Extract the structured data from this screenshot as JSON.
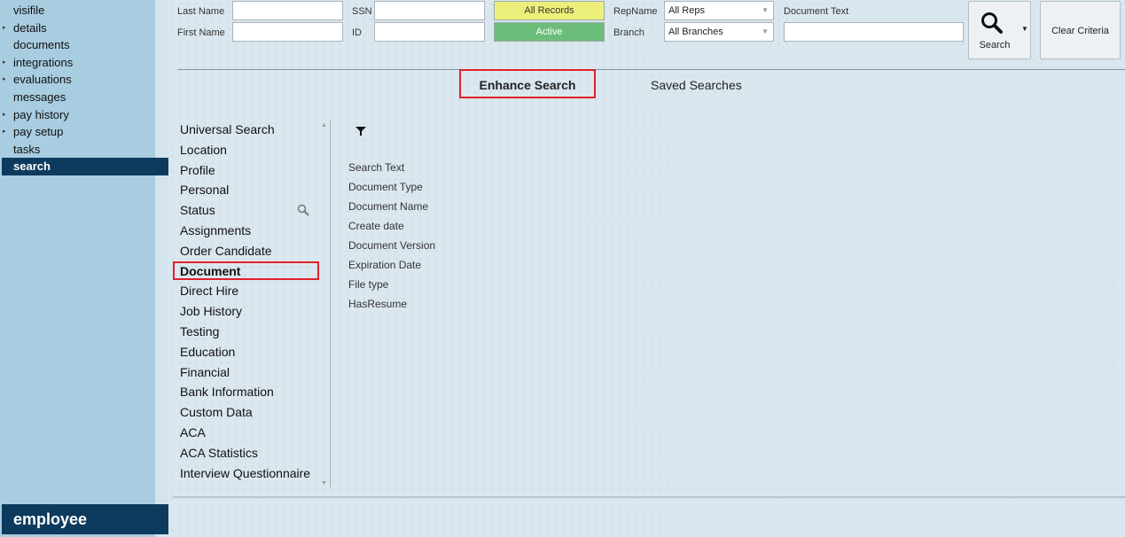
{
  "sidebar": {
    "items": [
      {
        "label": "visifile",
        "expandable": false
      },
      {
        "label": "details",
        "expandable": true
      },
      {
        "label": "documents",
        "expandable": false
      },
      {
        "label": "integrations",
        "expandable": true
      },
      {
        "label": "evaluations",
        "expandable": true
      },
      {
        "label": "messages",
        "expandable": false
      },
      {
        "label": "pay history",
        "expandable": true
      },
      {
        "label": "pay setup",
        "expandable": true
      },
      {
        "label": "tasks",
        "expandable": false
      },
      {
        "label": "search",
        "expandable": false,
        "active": true
      }
    ],
    "footer": "employee"
  },
  "criteria": {
    "last_name_label": "Last Name",
    "first_name_label": "First Name",
    "ssn_label": "SSN",
    "id_label": "ID",
    "all_records": "All Records",
    "active": "Active",
    "repname_label": "RepName",
    "repname_value": "All Reps",
    "branch_label": "Branch",
    "branch_value": "All Branches",
    "document_text_label": "Document Text",
    "search_button": "Search",
    "clear_button": "Clear Criteria"
  },
  "tabs": {
    "enhance": "Enhance Search",
    "saved": "Saved Searches"
  },
  "categories": [
    "Universal Search",
    "Location",
    "Profile",
    "Personal",
    "Status",
    "Assignments",
    "Order Candidate",
    "Document",
    "Direct Hire",
    "Job History",
    "Testing",
    "Education",
    "Financial",
    "Bank Information",
    "Custom Data",
    "ACA",
    "ACA Statistics",
    "Interview Questionnaire"
  ],
  "selected_category": "Document",
  "fields": [
    "Search Text",
    "Document Type",
    "Document Name",
    "Create date",
    "Document Version",
    "Expiration Date",
    "File type",
    "HasResume"
  ],
  "colors": {
    "sidebar_bg": "#a8cce0",
    "nav_active_bg": "#0d3b5e",
    "highlight_border": "#e0202a",
    "all_records_bg": "#ecf07a",
    "active_bg": "#6dbd7a"
  }
}
